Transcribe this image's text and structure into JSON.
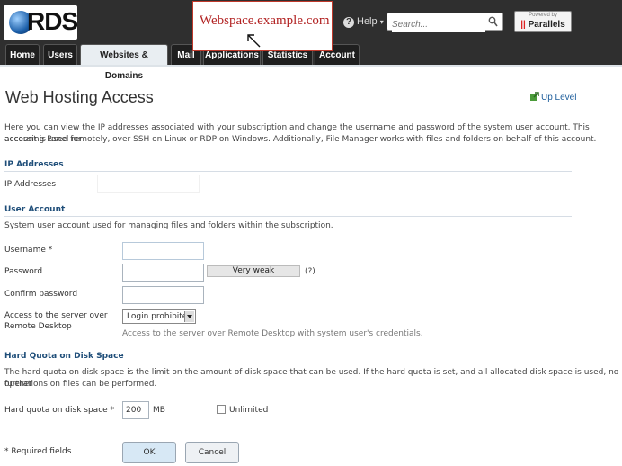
{
  "header": {
    "logo_text": "RDS",
    "domain_label": "Webspace.example.com",
    "help_label": "Help",
    "search_placeholder": "Search...",
    "parallels_powered": "Powered by",
    "parallels_name": "Parallels"
  },
  "tabs": [
    {
      "label": "Home"
    },
    {
      "label": "Users"
    },
    {
      "label": "Websites & Domains",
      "active": true
    },
    {
      "label": "Mail"
    },
    {
      "label": "Applications"
    },
    {
      "label": "Statistics"
    },
    {
      "label": "Account"
    }
  ],
  "page": {
    "title": "Web Hosting Access",
    "up_level": "Up Level",
    "intro_1": "Here you can view the IP addresses associated with your subscription and change the username and password of the system user account. This account is used for",
    "intro_2": "accessing Panel remotely, over SSH on Linux or RDP on Windows. Additionally, File Manager works with files and folders on behalf of this account."
  },
  "ip_section": {
    "heading": "IP Addresses",
    "label": "IP Addresses",
    "value": ""
  },
  "user_section": {
    "heading": "User Account",
    "description": "System user account used for managing files and folders within the subscription.",
    "username_label": "Username *",
    "username_value": "",
    "password_label": "Password",
    "password_value": "",
    "strength_label": "Very weak",
    "strength_help": "(?)",
    "confirm_label": "Confirm password",
    "confirm_value": "",
    "access_label_1": "Access to the server over",
    "access_label_2": "Remote Desktop",
    "access_selected": "Login prohibited",
    "access_note": "Access to the server over Remote Desktop with system user's credentials."
  },
  "quota_section": {
    "heading": "Hard Quota on Disk Space",
    "description_1": "The hard quota on disk space is the limit on the amount of disk space that can be used. If the hard quota is set, and all allocated disk space is used, no further",
    "description_2": "operations on files can be performed.",
    "label": "Hard quota on disk space *",
    "value": "200",
    "unit": "MB",
    "unlimited_label": "Unlimited",
    "unlimited_checked": false
  },
  "footer": {
    "required_note": "* Required fields",
    "ok_label": "OK",
    "cancel_label": "Cancel"
  }
}
